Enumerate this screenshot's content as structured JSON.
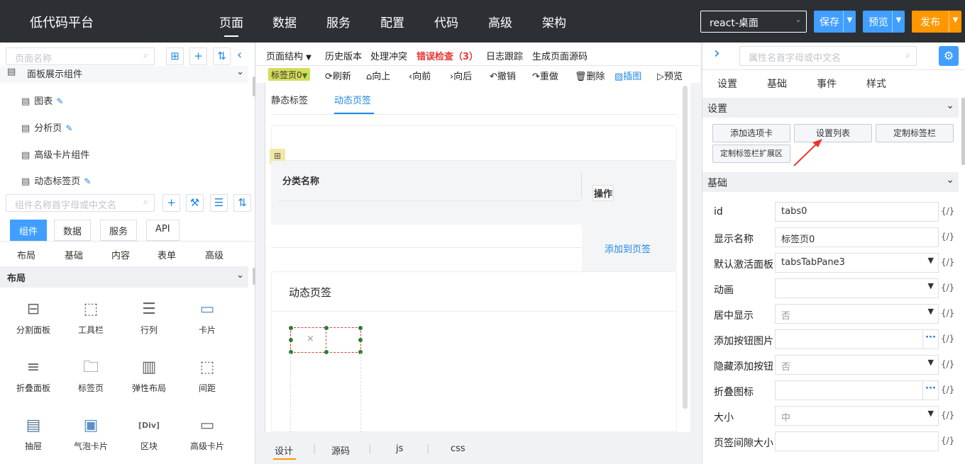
{
  "app": {
    "title": "低代码平台"
  },
  "nav": {
    "items": [
      "页面",
      "数据",
      "服务",
      "配置",
      "代码",
      "高级",
      "架构"
    ]
  },
  "header": {
    "target": "react-桌面",
    "save": "保存",
    "preview": "预览",
    "publish": "发布",
    "colors": {
      "save": "#409eff",
      "preview": "#409eff",
      "publish": "#ff9800"
    }
  },
  "left": {
    "page_search_placeholder": "页面名称",
    "tree_partial": "面板展示组件",
    "tree": [
      "图表",
      "分析页",
      "高级卡片组件",
      "动态标签页"
    ],
    "comp_search_placeholder": "组件名称首字母或中文名",
    "tabs": [
      "组件",
      "数据",
      "服务",
      "API"
    ],
    "subtabs": [
      "布局",
      "基础",
      "内容",
      "表单",
      "高级"
    ],
    "section": "布局",
    "components": [
      "分割面板",
      "工具栏",
      "行列",
      "卡片",
      "折叠面板",
      "标签页",
      "弹性布局",
      "间距",
      "抽屉",
      "气泡卡片",
      "区块",
      "高级卡片"
    ],
    "icons": [
      "split-icon",
      "toolbar-icon",
      "row-col-icon",
      "card-icon",
      "collapse-icon",
      "tabs-icon",
      "flex-icon",
      "spacing-icon",
      "drawer-icon",
      "popover-card-icon",
      "div-icon",
      "advanced-card-icon"
    ]
  },
  "center": {
    "toolbar": [
      "页面结构",
      "历史版本",
      "处理冲突",
      "错误检查（3）",
      "日志跟踪",
      "生成页面源码"
    ],
    "selected_tag": "标签页0",
    "actions": [
      "刷新",
      "向上",
      "向前",
      "向后",
      "撤销",
      "重做",
      "删除",
      "插图",
      "预览"
    ],
    "tabs": [
      "静态标签",
      "动态页签"
    ],
    "table_header": "分类名称",
    "table_action": "操作",
    "add_link": "添加到页签",
    "card_title": "动态页签",
    "bottom_tabs": [
      "设计",
      "源码",
      "js",
      "css"
    ]
  },
  "right": {
    "search_placeholder": "属性名首字母或中文名",
    "tabs": [
      "设置",
      "基础",
      "事件",
      "样式"
    ],
    "section_settings": "设置",
    "buttons": [
      "添加选项卡",
      "设置列表",
      "定制标签栏",
      "定制标签栏扩展区"
    ],
    "section_basic": "基础",
    "fx": "{/}",
    "props": [
      {
        "label": "id",
        "value": "tabs0"
      },
      {
        "label": "显示名称",
        "value": "标签页0"
      },
      {
        "label": "默认激活面板",
        "value": "tabsTabPane3"
      },
      {
        "label": "动画",
        "value": ""
      },
      {
        "label": "居中显示",
        "value": "否"
      },
      {
        "label": "添加按钮图片",
        "value": ""
      },
      {
        "label": "隐藏添加按钮",
        "value": "否"
      },
      {
        "label": "折叠图标",
        "value": ""
      },
      {
        "label": "大小",
        "value": "中"
      },
      {
        "label": "页签间隙大小",
        "value": ""
      }
    ]
  }
}
